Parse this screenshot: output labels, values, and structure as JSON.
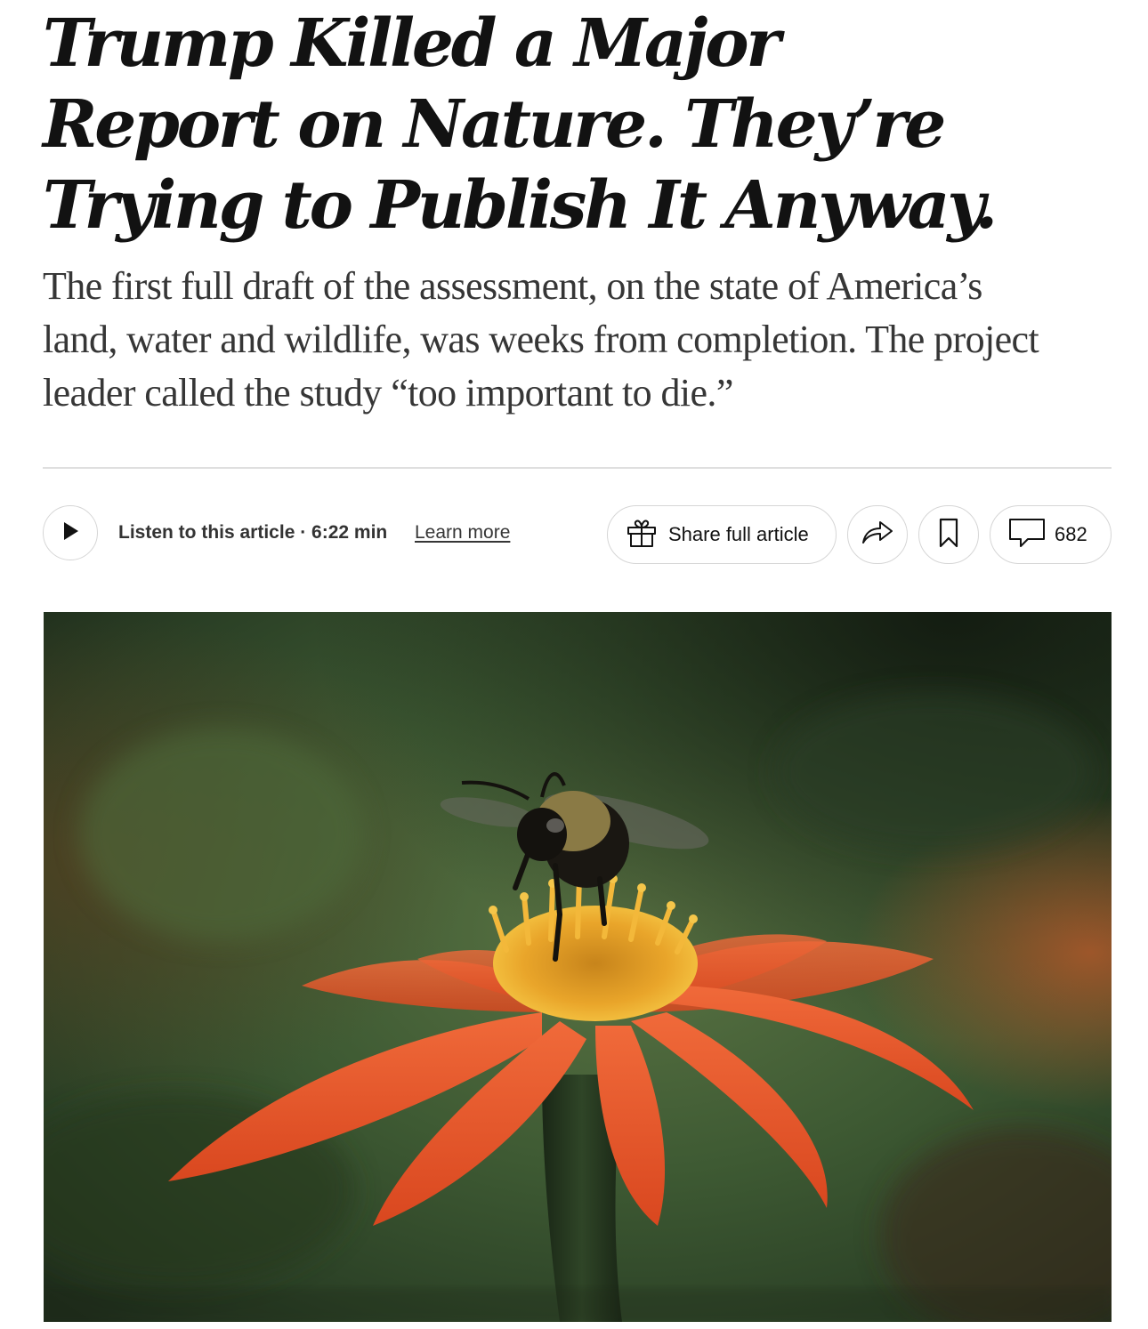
{
  "article": {
    "headline_lines": [
      "Trump Killed a Major",
      "Report on Nature. They’re",
      "Trying to Publish It Anyway."
    ],
    "summary_lines": [
      "The first full draft of the assessment, on the state of America’s",
      "land, water and wildlife, was weeks from completion. The project",
      "leader called the study “too important to die.”"
    ]
  },
  "toolbar": {
    "listen_label": "Listen to this article · 6:22 min",
    "learn_more_label": "Learn more",
    "share_full_label": "Share full article",
    "comments_count": "682",
    "icons": {
      "play": "play-icon",
      "gift": "gift-icon",
      "share": "share-arrow-icon",
      "bookmark": "bookmark-icon",
      "comment": "comment-bubble-icon"
    }
  },
  "lead_image": {
    "subject": "bee-on-orange-flower",
    "colors": {
      "background": "#2f4a2a",
      "petal": "#e8552b",
      "stamen": "#e9a52a"
    }
  },
  "colors": {
    "headline": "#121212",
    "summary": "#363636",
    "divider": "#dfdfdf",
    "button_border": "#d6d6d6"
  }
}
